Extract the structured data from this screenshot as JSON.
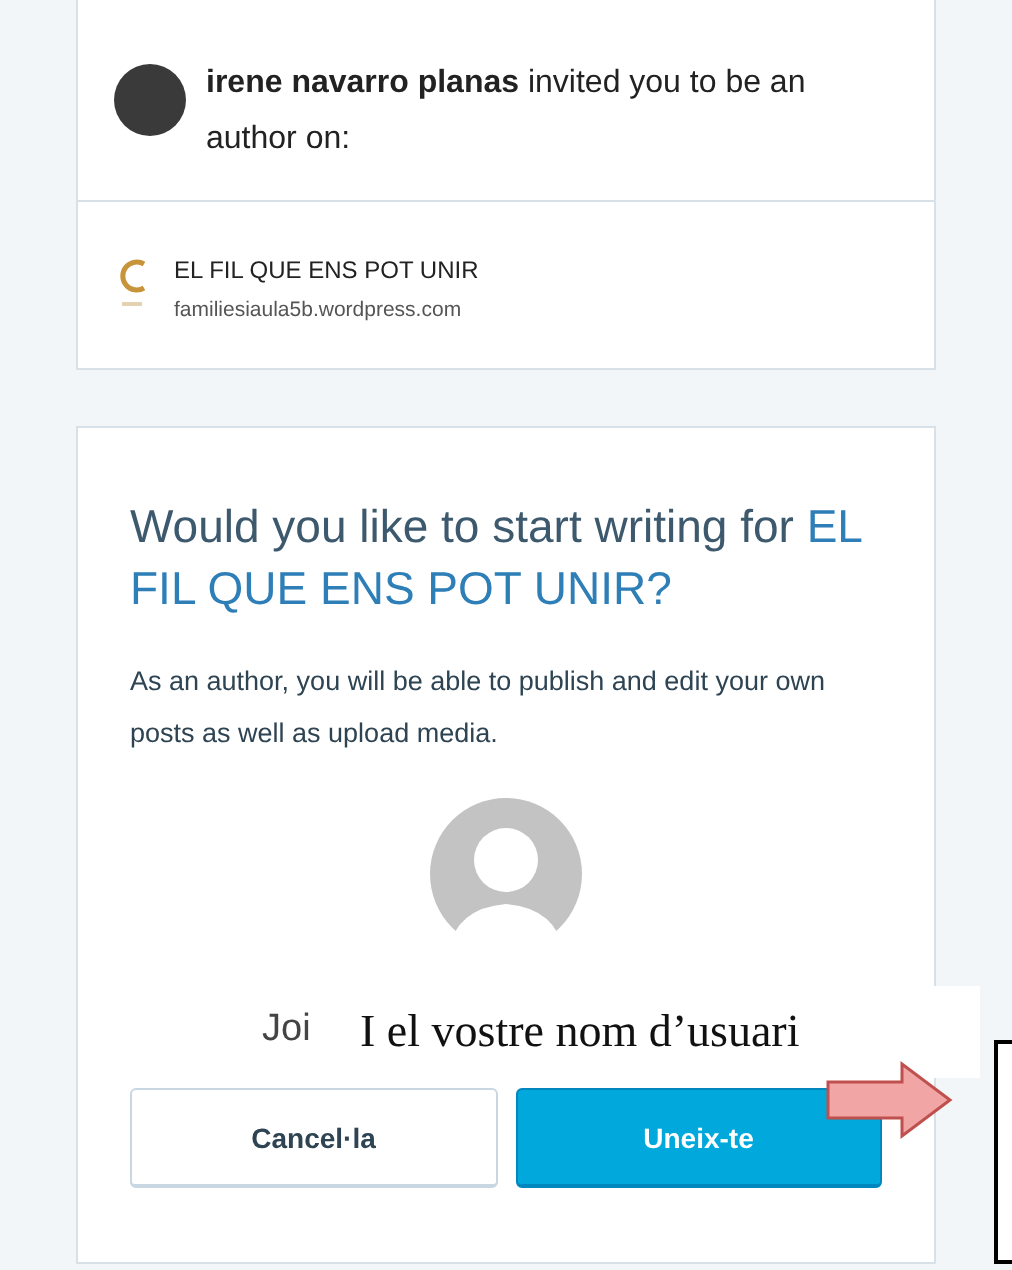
{
  "invite": {
    "message": "**irene navarro planas** invited you to be an author on:"
  },
  "site": {
    "name": "EL FIL QUE ENS POT UNIR",
    "url": "familiesiaula5b.wordpress.com"
  },
  "prompt": {
    "heading": "Would you like to start writing for ",
    "site_name": "EL FIL QUE ENS POT UNIR?",
    "description": "As an author, you will be able to publish and edit your own posts as well as upload media.",
    "join_text": "Joi"
  },
  "buttons": [
    {
      "label": "Cancel·la",
      "kind": "secondary"
    },
    {
      "label": "Uneix-te",
      "kind": "primary"
    }
  ],
  "annotation": {
    "text": "I el vostre nom d’usuari"
  }
}
